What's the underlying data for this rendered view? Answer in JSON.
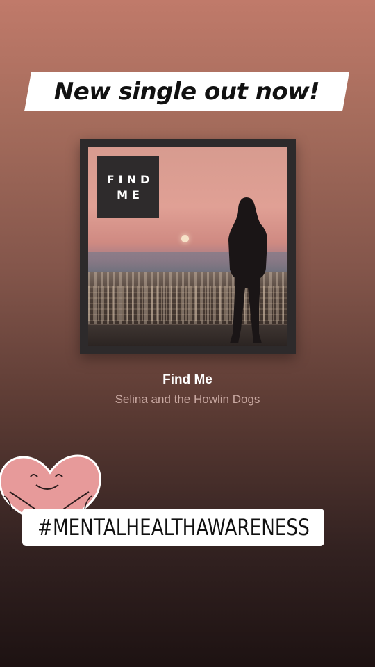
{
  "story": {
    "headline": "New single out now!",
    "hashtag": "#MENTALHEALTHAWARENESS"
  },
  "album": {
    "cover_title_line1": "FIND",
    "cover_title_line2": "ME"
  },
  "track": {
    "title": "Find Me",
    "artist": "Selina and the Howlin Dogs"
  },
  "stickers": {
    "heart": "hugging-heart-icon"
  },
  "colors": {
    "background_top": "#c07a6a",
    "background_bottom": "#1d1212",
    "album_frame": "#2d2a2b",
    "heart": "#e79a9a",
    "artist_text": "#c9a9a2"
  }
}
